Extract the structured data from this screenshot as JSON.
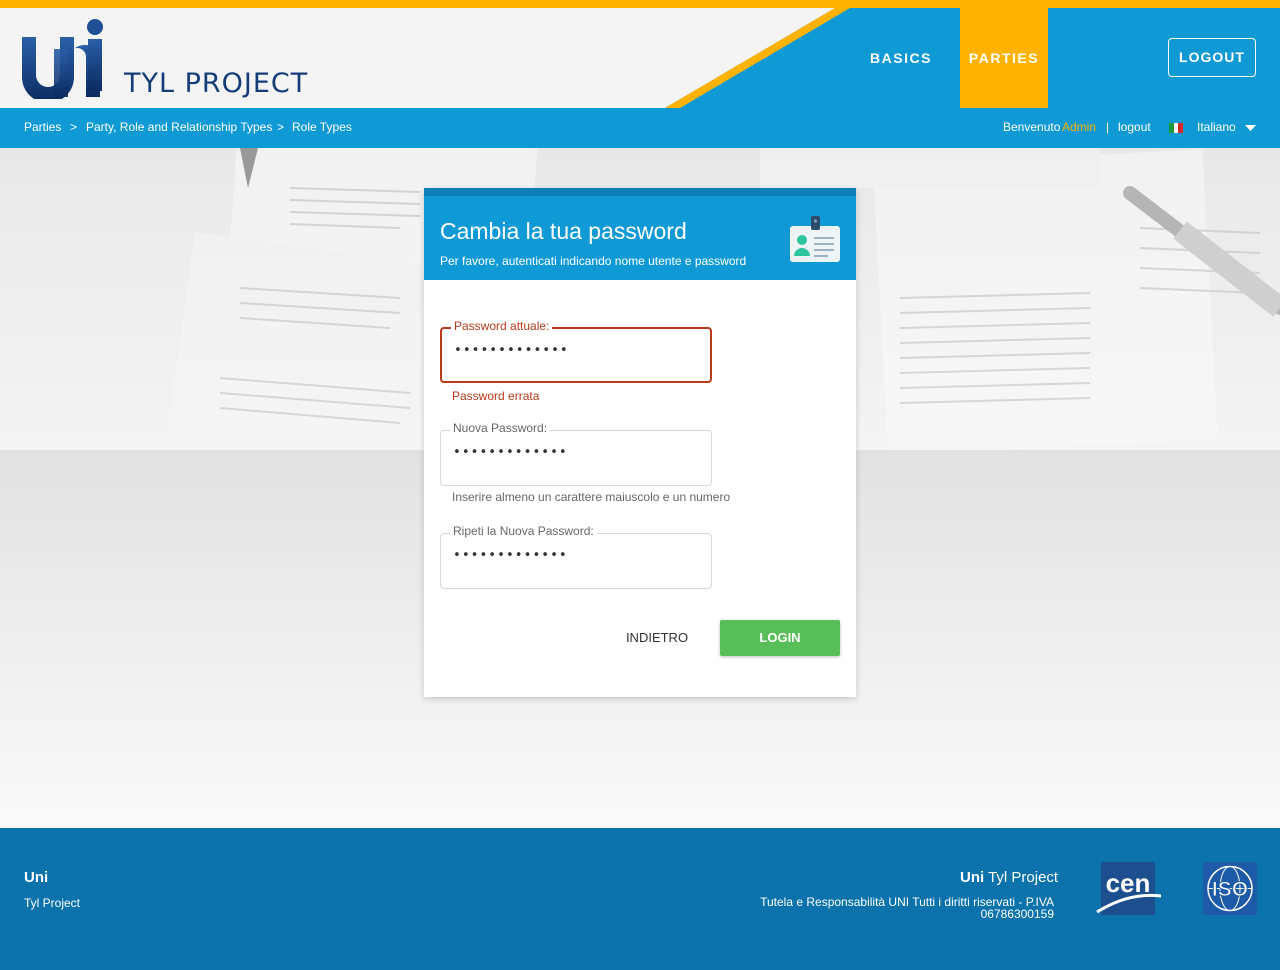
{
  "header": {
    "brand": "TYL PROJECT",
    "nav": [
      {
        "label": "BASICS",
        "active": false
      },
      {
        "label": "PARTIES",
        "active": true
      }
    ],
    "logout_label": "LOGOUT"
  },
  "breadcrumb": {
    "items": [
      "Parties",
      "Party, Role and Relationship Types",
      "Role Types"
    ],
    "separator": ">"
  },
  "user_bar": {
    "welcome": "Benvenuto",
    "user": "Admin",
    "divider": "|",
    "logout": "logout",
    "language": "Italiano"
  },
  "card": {
    "title": "Cambia la tua password",
    "subtitle": "Per favore, autenticati indicando nome utente e password",
    "fields": [
      {
        "label": "Password attuale:",
        "value": "•••••••••••••",
        "helper": "Password errata",
        "error": true
      },
      {
        "label": "Nuova Password:",
        "value": "•••••••••••••",
        "helper": "Inserire almeno un carattere maiuscolo e un numero",
        "error": false
      },
      {
        "label": "Ripeti la Nuova Password:",
        "value": "•••••••••••••",
        "helper": "",
        "error": false
      }
    ],
    "back_label": "INDIETRO",
    "login_label": "LOGIN"
  },
  "footer": {
    "left_title": "Uni",
    "left_sub": "Tyl Project",
    "right_title_bold": "Uni",
    "right_title_rest": "Tyl Project",
    "right_copy": "Tutela e Responsabilità UNI Tutti i diritti riservati - P.IVA 06786300159",
    "cen_text": "cen",
    "iso_text": "ISO"
  },
  "colors": {
    "primary_blue": "#0f9ad6",
    "accent_yellow": "#ffb300",
    "error_red": "#b83b1b",
    "login_green": "#58be58",
    "footer_blue": "#0b72ab"
  }
}
